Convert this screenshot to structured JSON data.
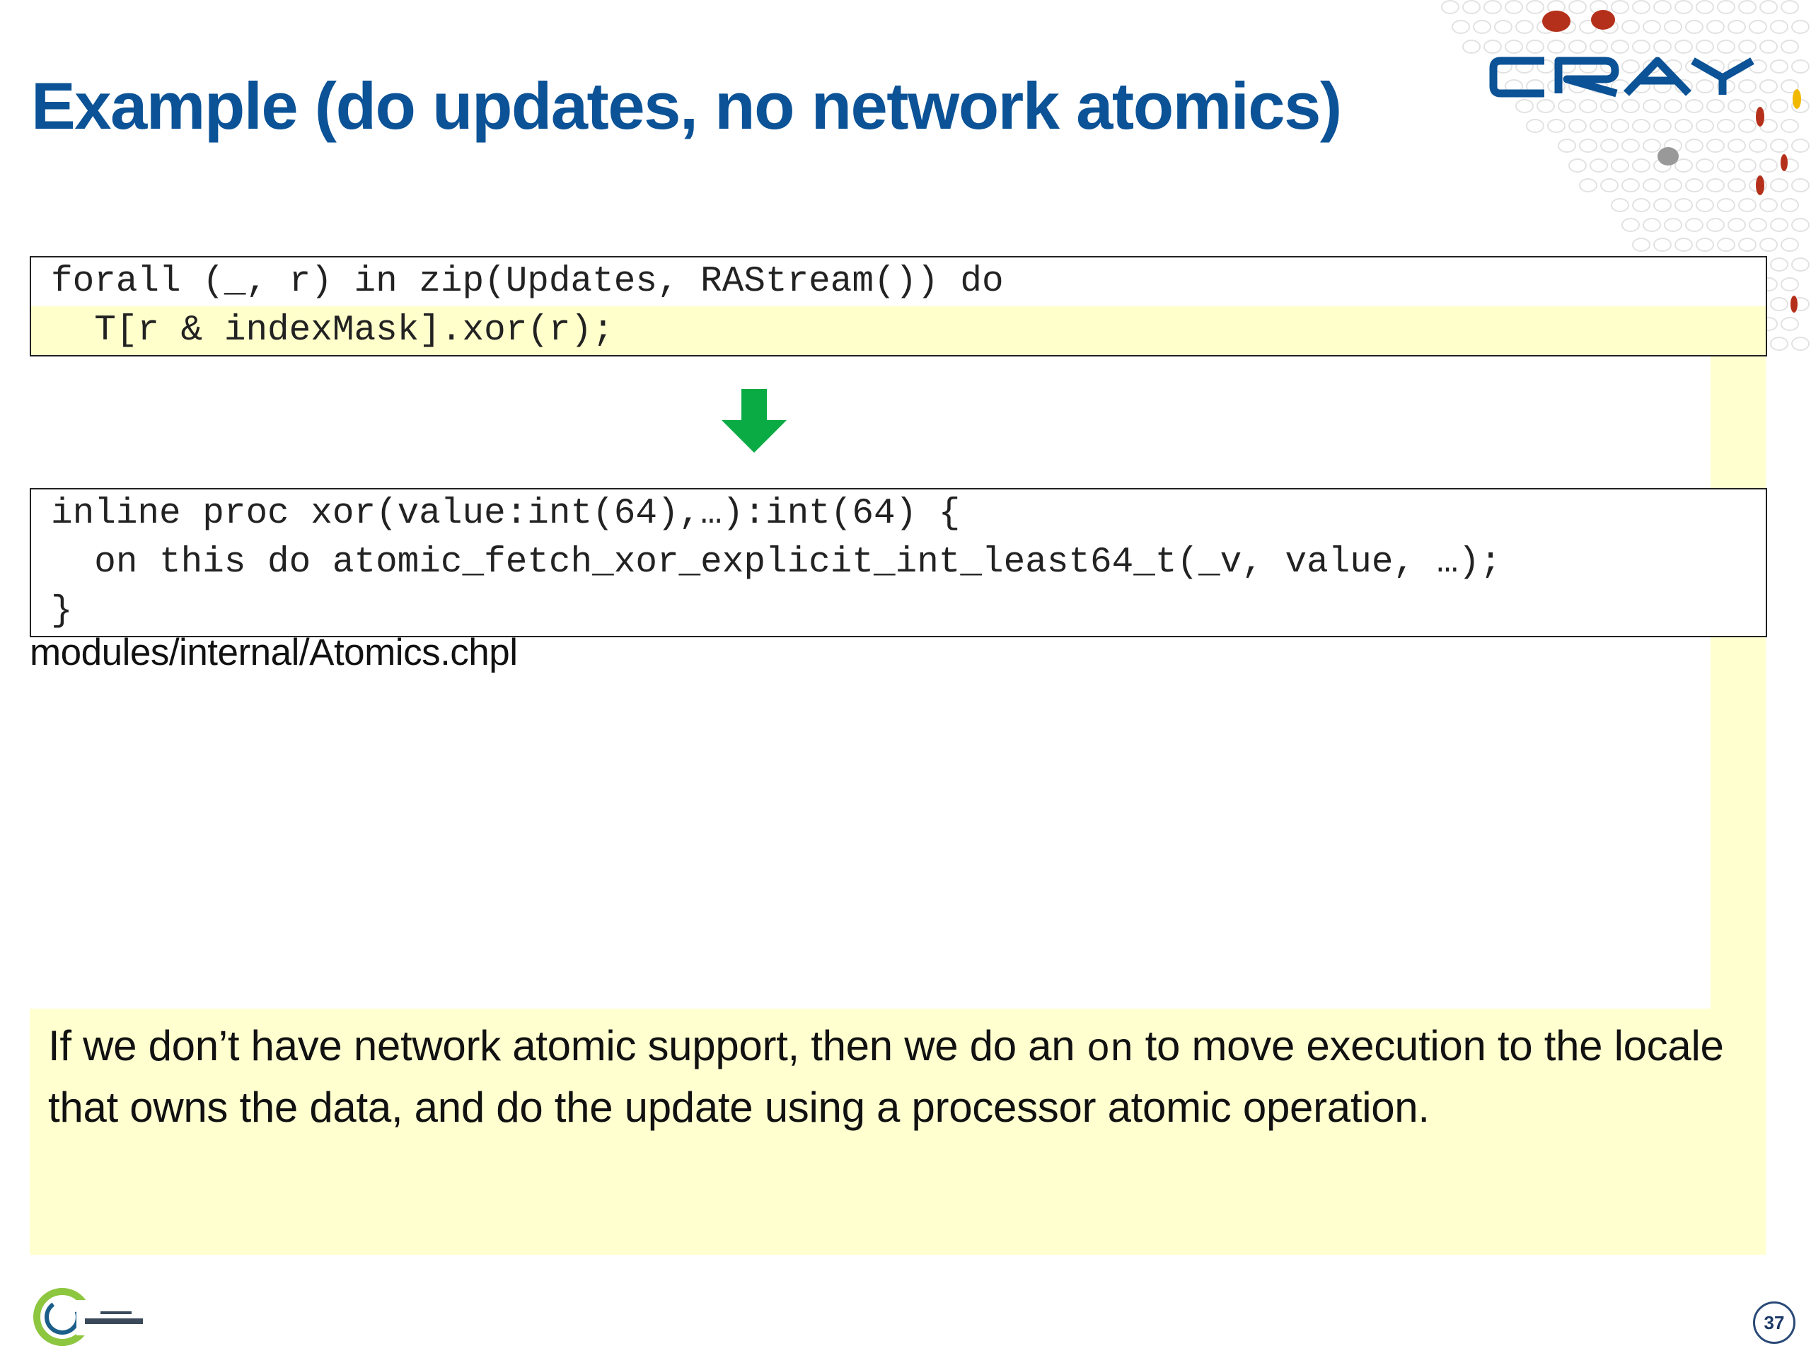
{
  "slide": {
    "title": "Example (do updates, no network atomics)",
    "logo_icon": "cray-logo",
    "footer_logo_icon": "chapel-logo",
    "page_number": "37"
  },
  "code_block_1": {
    "lines": [
      "forall (_, r) in zip(Updates, RAStream()) do",
      "  T[r & indexMask].xor(r);"
    ]
  },
  "arrow": {
    "icon": "down-arrow-icon",
    "color": "#0aaa44"
  },
  "code_block_2": {
    "lines": [
      "inline proc xor(value:int(64),…):int(64) {",
      "  on this do atomic_fetch_xor_explicit_int_least64_t(_v, value, …);",
      "}"
    ],
    "caption": "modules/internal/Atomics.chpl"
  },
  "description": {
    "before": "If we don’t have network atomic support, then we do an ",
    "keyword": "on",
    "after": " to move execution to the locale that owns the data, and do the update using a processor atomic operation."
  },
  "colors": {
    "title": "#0b5296",
    "highlight": "#ffffcc",
    "cray_blue": "#0b5296",
    "accent_red": "#b5301a"
  }
}
